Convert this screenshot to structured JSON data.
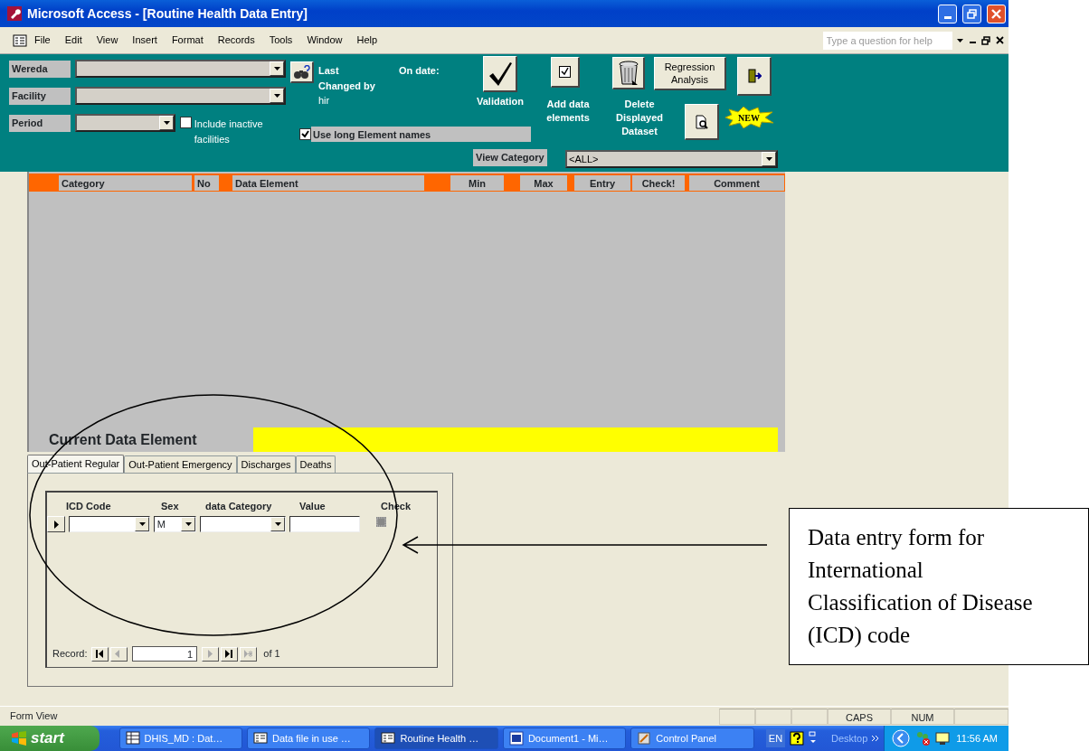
{
  "window": {
    "title": "Microsoft Access - [Routine Health Data Entry]"
  },
  "menu": [
    "File",
    "Edit",
    "View",
    "Insert",
    "Format",
    "Records",
    "Tools",
    "Window",
    "Help"
  ],
  "help_box": {
    "placeholder": "Type a question for help"
  },
  "header": {
    "fields": [
      {
        "label": "Wereda"
      },
      {
        "label": "Facility"
      },
      {
        "label": "Period"
      }
    ],
    "last_changed_label": "Last Changed by",
    "last_changed_value": "hir",
    "on_date_label": "On date:",
    "include_inactive": {
      "label": "Include inactive facilities",
      "checked": false
    },
    "long_names": {
      "label": "Use long Element names",
      "checked": true
    },
    "buttons": [
      {
        "kind": "check",
        "caption": "Validation"
      },
      {
        "kind": "checkbox",
        "caption": "Add data elements"
      },
      {
        "kind": "trash",
        "caption": "Delete Displayed Dataset"
      },
      {
        "kind": "text",
        "label": "Regression Analysis"
      },
      {
        "kind": "exit"
      },
      {
        "kind": "preview"
      },
      {
        "kind": "new",
        "label": "NEW"
      }
    ],
    "view_category": {
      "label": "View Category",
      "value": "<ALL>"
    }
  },
  "grid": {
    "columns": [
      "Category",
      "No",
      "Data Element",
      "Min",
      "Max",
      "Entry",
      "Check!",
      "Comment"
    ]
  },
  "current_element": {
    "label": "Current Data Element"
  },
  "tabs": [
    {
      "label": "Out-Patient Regular",
      "selected": true
    },
    {
      "label": "Out-Patient Emergency",
      "selected": false
    },
    {
      "label": "Discharges",
      "selected": false
    },
    {
      "label": "Deaths",
      "selected": false
    }
  ],
  "subform": {
    "columns": [
      "ICD Code",
      "Sex",
      "data Category",
      "Value",
      "Check"
    ],
    "sex_value": "M",
    "navigator": {
      "label": "Record:",
      "current": "1",
      "total": "of 1"
    }
  },
  "status_bar": {
    "mode": "Form View",
    "indicators": [
      "CAPS",
      "NUM"
    ]
  },
  "taskbar": {
    "start": "start",
    "tasks": [
      {
        "kind": "table",
        "label": "DHIS_MD : Dat…",
        "selected": false
      },
      {
        "kind": "form",
        "label": "Data file in use …",
        "selected": false
      },
      {
        "kind": "form",
        "label": "Routine Health …",
        "selected": true
      },
      {
        "kind": "word",
        "label": "Document1 - Mi…",
        "selected": false
      },
      {
        "kind": "panel",
        "label": "Control Panel",
        "selected": false
      }
    ],
    "language": "EN",
    "desktop": "Desktop",
    "clock": "11:56 AM"
  },
  "annotation": {
    "text": "Data entry form for International Classification of Disease (ICD) code"
  }
}
